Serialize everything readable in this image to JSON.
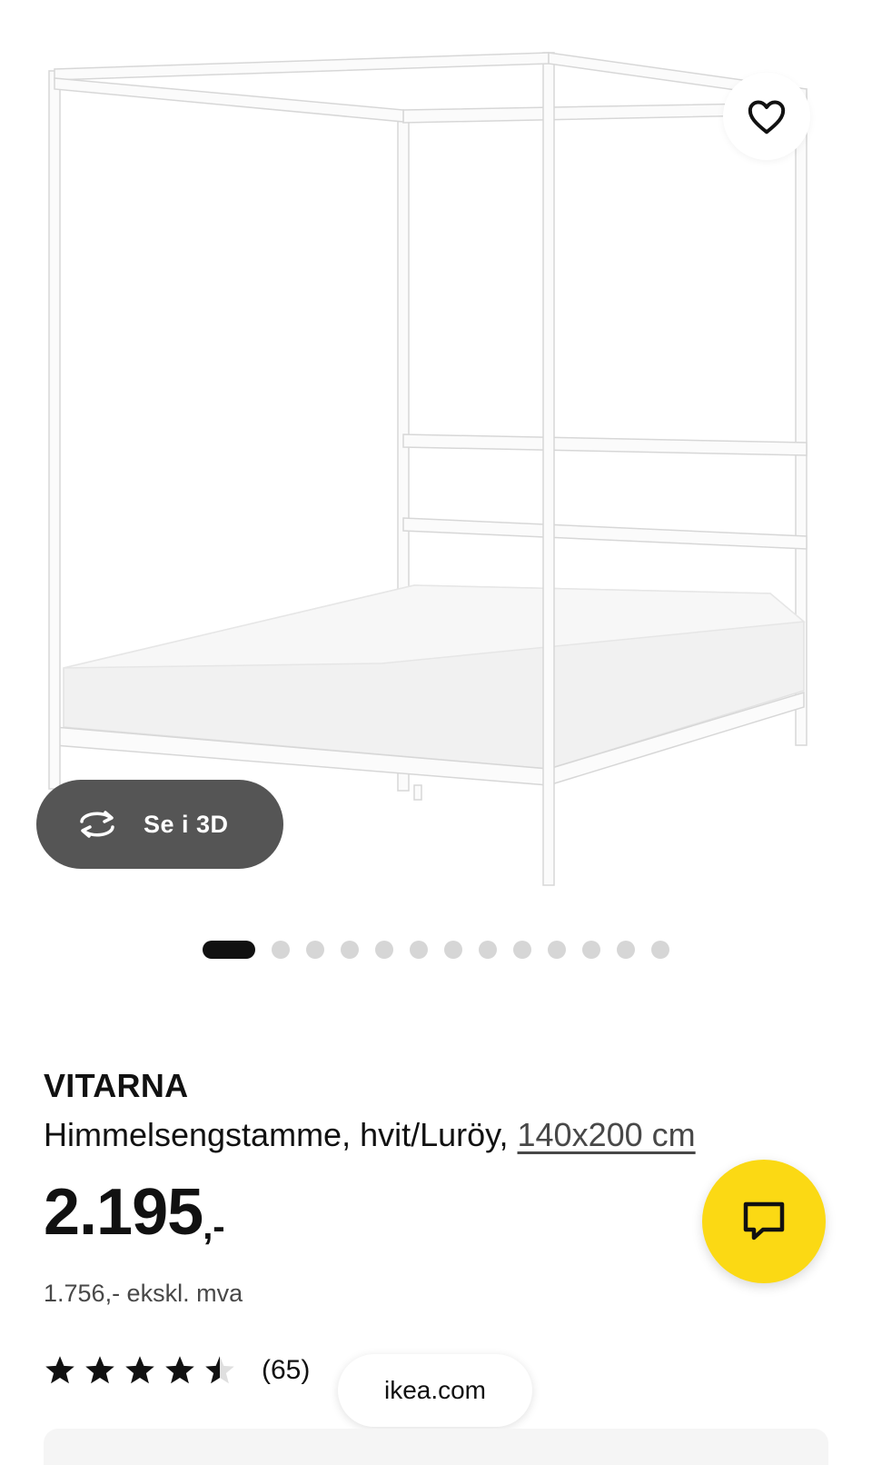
{
  "product": {
    "brand": "VITARNA",
    "description": "Himmelsengstamme, hvit/Luröy,",
    "size": "140x200 cm",
    "price_main": "2.195",
    "price_suffix": ",-",
    "price_ex_vat": "1.756,- ekskl. mva",
    "rating": 4.5,
    "rating_max": 5,
    "review_count": "(65)"
  },
  "gallery": {
    "view3d_label": "Se i 3D",
    "image_count": 13,
    "active_index": 0
  },
  "browser": {
    "url": "ikea.com"
  },
  "icons": {
    "favorite": "heart-icon",
    "view3d": "rotate-3d-icon",
    "chat": "chat-bubble-icon",
    "rating": "star-icon"
  },
  "colors": {
    "accent_yellow": "#fbd914",
    "view3d_bg": "#555555",
    "text": "#111111",
    "secondary_text": "#484848",
    "dot_inactive": "#d6d6d6"
  }
}
